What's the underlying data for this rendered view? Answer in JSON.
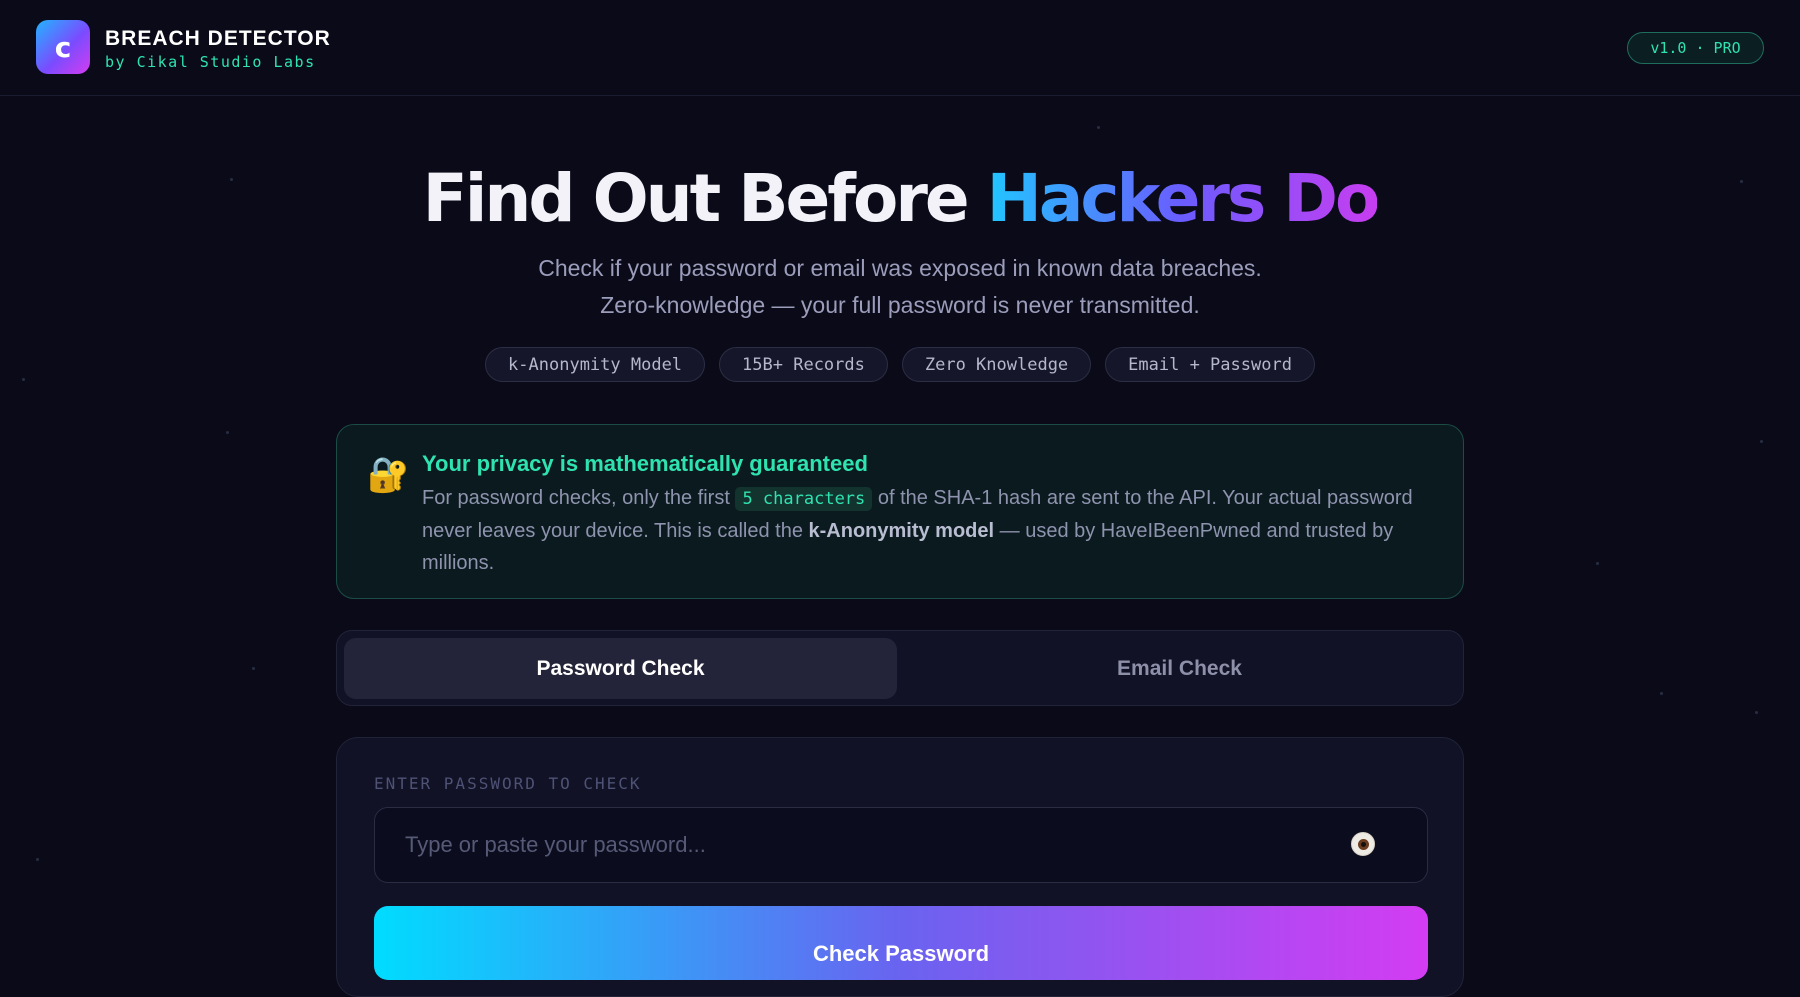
{
  "header": {
    "logo_letter": "c",
    "brand_title": "BREACH DETECTOR",
    "brand_subtitle": "by Cikal Studio Labs",
    "version_badge": "v1.0 · PRO"
  },
  "hero": {
    "title_main": "Find Out Before ",
    "title_accent": "Hackers Do",
    "subtitle_line1": "Check if your password or email was exposed in known data breaches.",
    "subtitle_line2": "Zero-knowledge — your full password is never transmitted.",
    "chips": [
      "k-Anonymity Model",
      "15B+ Records",
      "Zero Knowledge",
      "Email + Password"
    ]
  },
  "privacy": {
    "icon": "lock-key-icon",
    "title": "Your privacy is mathematically guaranteed",
    "body_part1": "For password checks, only the first ",
    "body_code": "5 characters",
    "body_part2": " of the SHA-1 hash are sent to the API. Your actual password never leaves your device. This is called the ",
    "body_strong": "k-Anonymity model",
    "body_part3": " — used by HaveIBeenPwned and trusted by millions."
  },
  "tabs": [
    {
      "label": "Password Check",
      "active": true
    },
    {
      "label": "Email Check",
      "active": false
    }
  ],
  "form": {
    "label": "ENTER PASSWORD TO CHECK",
    "placeholder": "Type or paste your password...",
    "value": "",
    "toggle_icon": "eye-icon",
    "submit_label": "Check Password"
  },
  "colors": {
    "background": "#0a0a18",
    "accent_green": "#2fe3b0",
    "gradient_start": "#00dcff",
    "gradient_mid": "#6a63f0",
    "gradient_end": "#d33cf2"
  }
}
